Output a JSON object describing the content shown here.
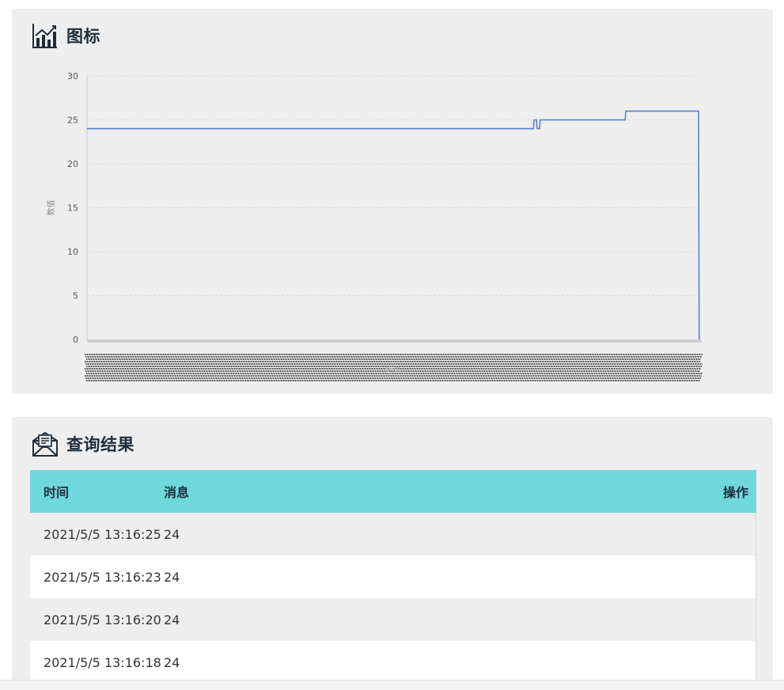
{
  "chart_panel": {
    "title": "图标",
    "icon": "chart-trend-icon"
  },
  "chart_data": {
    "type": "line",
    "title": "",
    "xlabel": "时间",
    "ylabel": "数值",
    "ylim": [
      0,
      30
    ],
    "yticks": [
      0,
      5,
      10,
      15,
      20,
      25,
      30
    ],
    "grid": true,
    "legend": "none",
    "line_color": "#5b7fce",
    "series": [
      {
        "x": [
          0,
          0.73,
          0.731,
          0.735,
          0.736,
          0.74,
          0.741,
          0.88,
          0.881,
          1.0,
          1.001
        ],
        "values": [
          24,
          24,
          25,
          25,
          24,
          24,
          25,
          25,
          26,
          26,
          0
        ]
      }
    ]
  },
  "result_panel": {
    "title": "查询结果",
    "icon": "mail-open-icon"
  },
  "table": {
    "headers": {
      "time": "时间",
      "message": "消息",
      "action": "操作"
    },
    "rows": [
      {
        "time": "2021/5/5 13:16:25",
        "message": "24"
      },
      {
        "time": "2021/5/5 13:16:23",
        "message": "24"
      },
      {
        "time": "2021/5/5 13:16:20",
        "message": "24"
      },
      {
        "time": "2021/5/5 13:16:18",
        "message": "24"
      }
    ]
  }
}
